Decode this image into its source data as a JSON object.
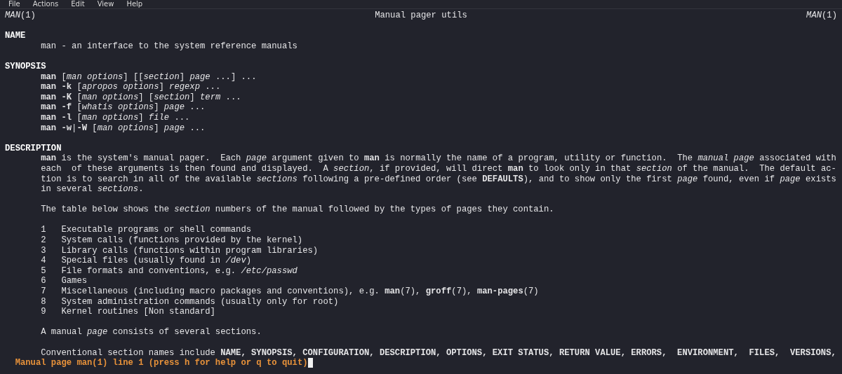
{
  "menu": [
    {
      "label": "File"
    },
    {
      "label": "Actions"
    },
    {
      "label": "Edit"
    },
    {
      "label": "View"
    },
    {
      "label": "Help"
    }
  ],
  "header": {
    "left": "*MAN*(1)",
    "center": "Manual pager utils",
    "right": "*MAN*(1)"
  },
  "sections": [
    {
      "heading": "NAME",
      "blocks": [
        {
          "kind": "text",
          "text": "man - an interface to the system reference manuals"
        }
      ]
    },
    {
      "heading": "SYNOPSIS",
      "blocks": [
        {
          "kind": "text",
          "text": "**man** [*man* *options*] [[*section*] *page* ...] ...\n**man -k** [*apropos* *options*] *regexp* ...\n**man -K** [*man* *options*] [*section*] *term* ...\n**man -f** [*whatis* *options*] *page* ...\n**man -l** [*man* *options*] *file* ...\n**man -w**|**-W** [*man* *options*] *page* ..."
        }
      ]
    },
    {
      "heading": "DESCRIPTION",
      "blocks": [
        {
          "kind": "text",
          "text": "**man** is the system's manual pager.  Each *page* argument given to **man** is normally the name of a program, utility or function.  The *manual* *page* associated with\neach  of these arguments is then found and displayed.  A *section*, if provided, will direct **man** to look only in that *section* of the manual.  The default ac-\ntion is to search in all of the available *sections* following a pre-defined order (see **DEFAULTS**), and to show only the first *page* found, even if *page* exists\nin several *sections*."
        },
        {
          "kind": "text",
          "text": "The table below shows the *section* numbers of the manual followed by the types of pages they contain."
        },
        {
          "kind": "list",
          "rows": [
            {
              "number": "1",
              "text": "Executable programs or shell commands"
            },
            {
              "number": "2",
              "text": "System calls (functions provided by the kernel)"
            },
            {
              "number": "3",
              "text": "Library calls (functions within program libraries)"
            },
            {
              "number": "4",
              "text": "Special files (usually found in */dev*)"
            },
            {
              "number": "5",
              "text": "File formats and conventions, e.g. */etc/passwd*"
            },
            {
              "number": "6",
              "text": "Games"
            },
            {
              "number": "7",
              "text": "Miscellaneous (including macro packages and conventions), e.g. **man**(7), **groff**(7), **man-pages**(7)"
            },
            {
              "number": "8",
              "text": "System administration commands (usually only for root)"
            },
            {
              "number": "9",
              "text": "Kernel routines [Non standard]"
            }
          ]
        },
        {
          "kind": "text",
          "text": "A manual *page* consists of several sections."
        },
        {
          "kind": "text",
          "text": "Conventional section names include **NAME, SYNOPSIS, CONFIGURATION, DESCRIPTION, OPTIONS, EXIT STATUS, RETURN VALUE, ERRORS,  ENVIRONMENT,  FILES,  VERSIONS,**"
        }
      ]
    }
  ],
  "status_line": "Manual page man(1) line 1 (press h for help or q to quit)"
}
